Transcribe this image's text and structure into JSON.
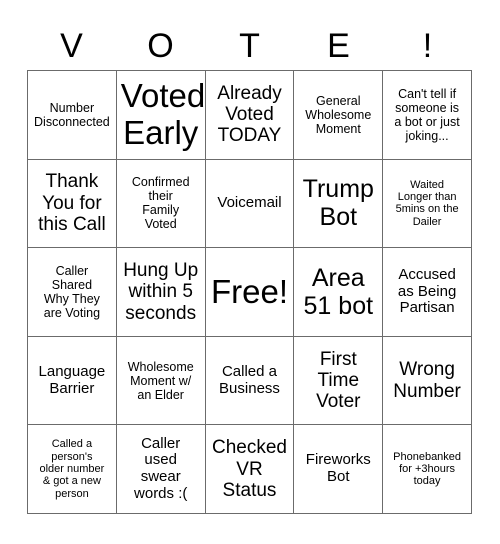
{
  "header": {
    "letters": [
      "V",
      "O",
      "T",
      "E",
      "!"
    ]
  },
  "grid": {
    "columns": 5,
    "rows": 5,
    "border_color": "#6b6b6b",
    "background_color": "#ffffff",
    "text_color": "#000000",
    "cells": [
      {
        "text": "Number\nDisconnected",
        "size": "sm",
        "free": false
      },
      {
        "text": "Voted\nEarly",
        "size": "xxl",
        "free": false
      },
      {
        "text": "Already\nVoted\nTODAY",
        "size": "lg",
        "free": false
      },
      {
        "text": "General\nWholesome\nMoment",
        "size": "sm",
        "free": false
      },
      {
        "text": "Can't tell if\nsomeone is\na bot or just\njoking...",
        "size": "sm",
        "free": false
      },
      {
        "text": "Thank\nYou for\nthis Call",
        "size": "lg",
        "free": false
      },
      {
        "text": "Confirmed\ntheir\nFamily\nVoted",
        "size": "sm",
        "free": false
      },
      {
        "text": "Voicemail",
        "size": "md",
        "free": false
      },
      {
        "text": "Trump\nBot",
        "size": "xl",
        "free": false
      },
      {
        "text": "Waited\nLonger than\n5mins on the\nDailer",
        "size": "xs",
        "free": false
      },
      {
        "text": "Caller\nShared\nWhy They\nare Voting",
        "size": "sm",
        "free": false
      },
      {
        "text": "Hung Up\nwithin 5\nseconds",
        "size": "lg",
        "free": false
      },
      {
        "text": "Free!",
        "size": "xxl",
        "free": true
      },
      {
        "text": "Area\n51 bot",
        "size": "xl",
        "free": false
      },
      {
        "text": "Accused\nas Being\nPartisan",
        "size": "md",
        "free": false
      },
      {
        "text": "Language\nBarrier",
        "size": "md",
        "free": false
      },
      {
        "text": "Wholesome\nMoment w/\nan Elder",
        "size": "sm",
        "free": false
      },
      {
        "text": "Called a\nBusiness",
        "size": "md",
        "free": false
      },
      {
        "text": "First\nTime\nVoter",
        "size": "lg",
        "free": false
      },
      {
        "text": "Wrong\nNumber",
        "size": "lg",
        "free": false
      },
      {
        "text": "Called a\nperson's\nolder number\n& got a new\nperson",
        "size": "xs",
        "free": false
      },
      {
        "text": "Caller\nused\nswear\nwords :(",
        "size": "md",
        "free": false
      },
      {
        "text": "Checked\nVR\nStatus",
        "size": "lg",
        "free": false
      },
      {
        "text": "Fireworks\nBot",
        "size": "md",
        "free": false
      },
      {
        "text": "Phonebanked\nfor +3hours\ntoday",
        "size": "xs",
        "free": false
      }
    ]
  }
}
